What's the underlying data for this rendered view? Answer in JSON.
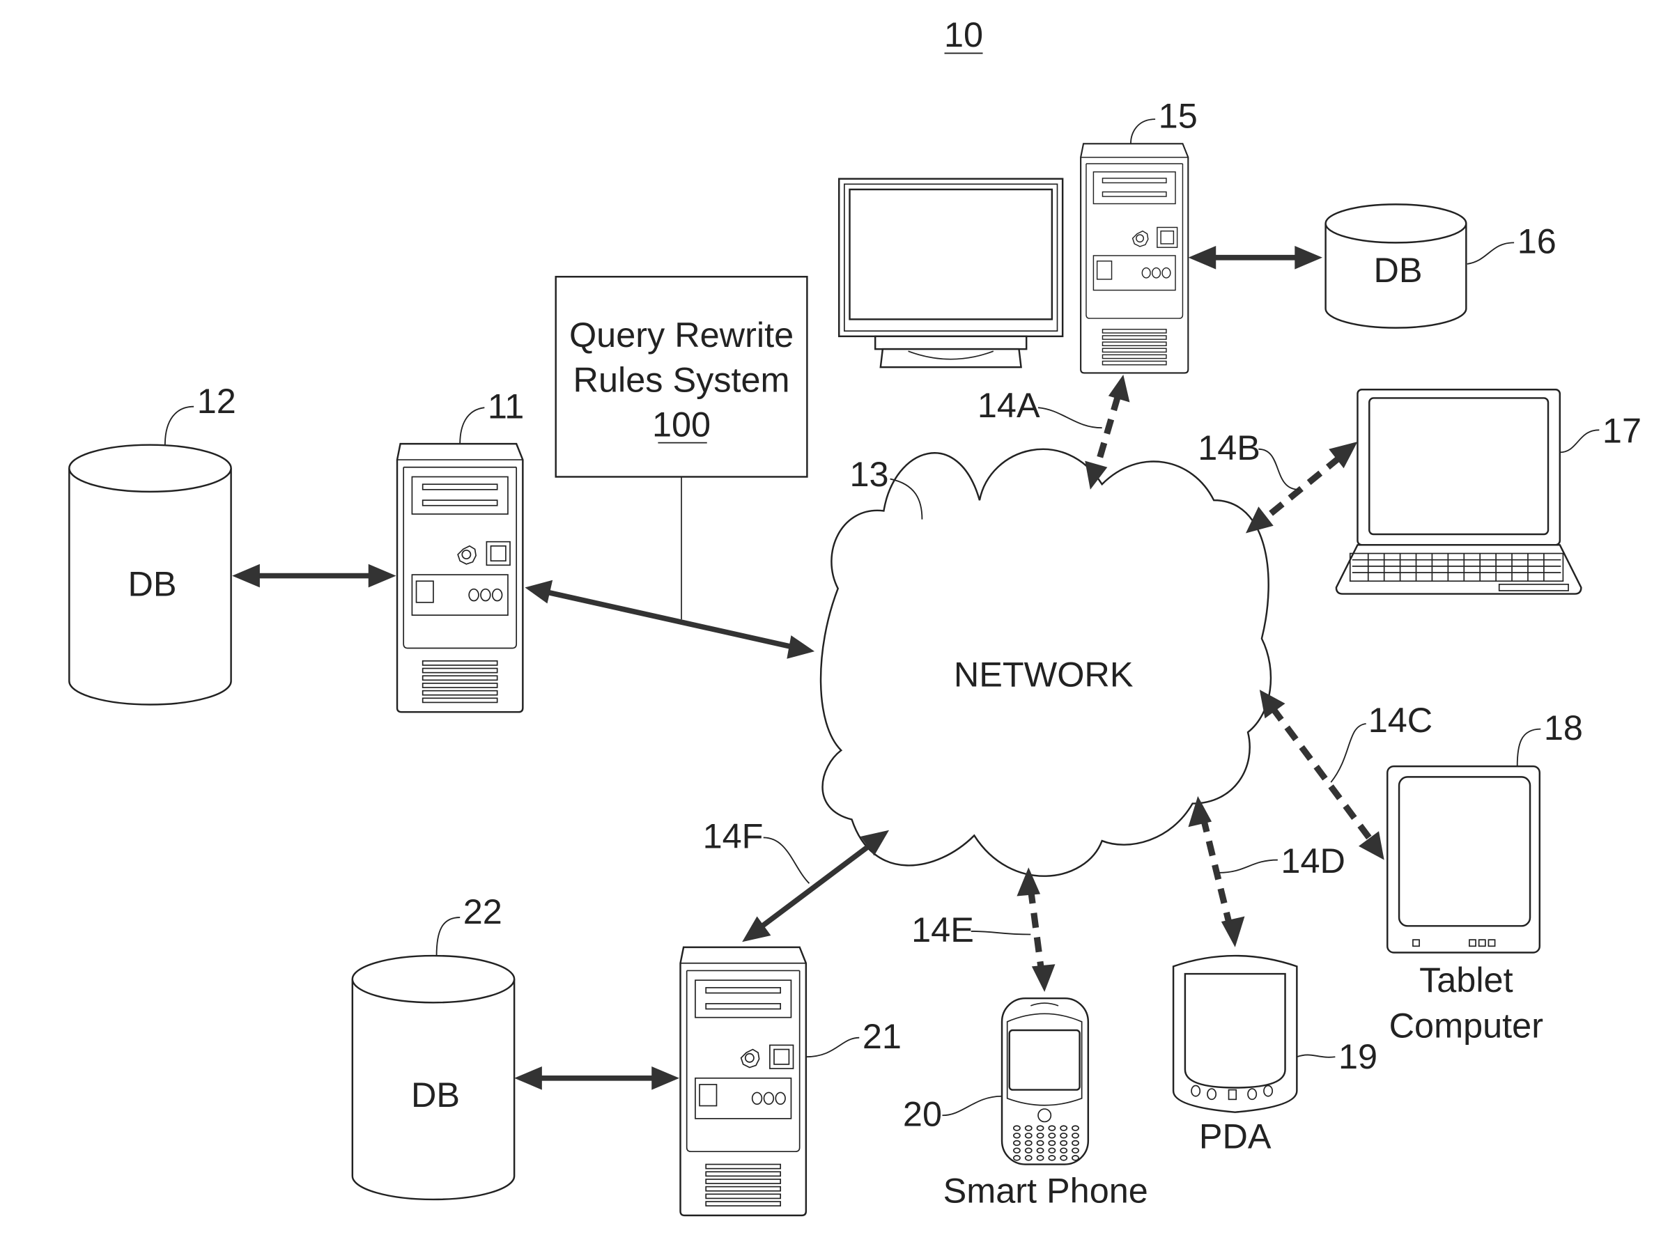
{
  "figure": {
    "number": "10",
    "title_underlined": true
  },
  "network": {
    "label": "NETWORK",
    "ref": "13"
  },
  "query_rewrite_box": {
    "line1": "Query Rewrite",
    "line2": "Rules System",
    "ref": "100"
  },
  "nodes": [
    {
      "id": "server-11",
      "type": "server",
      "ref": "11"
    },
    {
      "id": "db-12",
      "type": "database",
      "label": "DB",
      "ref": "12"
    },
    {
      "id": "workstation-15",
      "type": "server-with-monitor",
      "ref": "15"
    },
    {
      "id": "db-16",
      "type": "database",
      "label": "DB",
      "ref": "16"
    },
    {
      "id": "laptop-17",
      "type": "laptop",
      "ref": "17"
    },
    {
      "id": "tablet-18",
      "type": "tablet",
      "label_line1": "Tablet",
      "label_line2": "Computer",
      "ref": "18"
    },
    {
      "id": "pda-19",
      "type": "pda",
      "label": "PDA",
      "ref": "19"
    },
    {
      "id": "phone-20",
      "type": "smart-phone",
      "label": "Smart Phone",
      "ref": "20"
    },
    {
      "id": "server-21",
      "type": "server",
      "ref": "21"
    },
    {
      "id": "db-22",
      "type": "database",
      "label": "DB",
      "ref": "22"
    }
  ],
  "links": [
    {
      "ref": "14A",
      "from": "workstation-15",
      "to": "network",
      "style": "dashed"
    },
    {
      "ref": "14B",
      "from": "laptop-17",
      "to": "network",
      "style": "dashed"
    },
    {
      "ref": "14C",
      "from": "tablet-18",
      "to": "network",
      "style": "dashed"
    },
    {
      "ref": "14D",
      "from": "pda-19",
      "to": "network",
      "style": "dashed"
    },
    {
      "ref": "14E",
      "from": "phone-20",
      "to": "network",
      "style": "dashed"
    },
    {
      "ref": "14F",
      "from": "server-21",
      "to": "network",
      "style": "solid"
    }
  ],
  "labels": {
    "db12": "DB",
    "db16": "DB",
    "db22": "DB",
    "ref11": "11",
    "ref12": "12",
    "ref15": "15",
    "ref16": "16",
    "ref17": "17",
    "ref18": "18",
    "ref19": "19",
    "ref20": "20",
    "ref21": "21",
    "ref22": "22",
    "ref14A": "14A",
    "ref14B": "14B",
    "ref14C": "14C",
    "ref14D": "14D",
    "ref14E": "14E",
    "ref14F": "14F",
    "tablet1": "Tablet",
    "tablet2": "Computer",
    "pda": "PDA",
    "phone": "Smart Phone"
  }
}
